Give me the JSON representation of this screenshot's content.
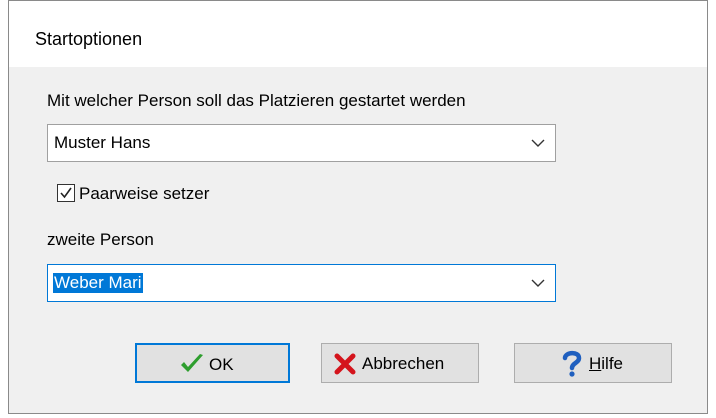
{
  "window": {
    "title": "Startoptionen"
  },
  "prompt_label": "Mit welcher Person soll das Platzieren gestartet werden",
  "first_person_select": {
    "selected": "Muster Hans"
  },
  "pair_checkbox": {
    "label": "Paarweise setzer",
    "checked": true
  },
  "second_person_label": "zweite Person",
  "second_person_select": {
    "selected": "Weber Mari"
  },
  "buttons": {
    "ok": {
      "label": "OK",
      "icon": "green-checkmark-icon"
    },
    "cancel": {
      "label": "Abbrechen",
      "icon": "red-x-icon"
    },
    "help": {
      "label_first": "H",
      "label_rest": "ilfe",
      "icon": "blue-question-icon"
    }
  },
  "colors": {
    "focus": "#0078d7",
    "ok_icon": "#2e9e2e",
    "cancel_icon": "#d4141c",
    "help_icon": "#1f5fbf"
  }
}
